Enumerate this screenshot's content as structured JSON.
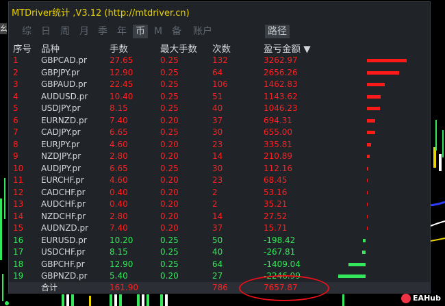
{
  "window": {
    "title": "MTDriver统计 ,V3.12 (http://mtdriver.cn)"
  },
  "side_tag": "幺",
  "tabs": [
    {
      "label": "综"
    },
    {
      "label": "日"
    },
    {
      "label": "周"
    },
    {
      "label": "月"
    },
    {
      "label": "季"
    },
    {
      "label": "年"
    },
    {
      "label": "币"
    },
    {
      "label": "M"
    },
    {
      "label": "备"
    },
    {
      "label": "账户"
    }
  ],
  "active_tab": "币",
  "route_button": "路径",
  "columns": {
    "seq": "序号",
    "symbol": "品种",
    "lots": "手数",
    "max_lots": "最大手数",
    "count": "次数",
    "profit": "盈亏金额 ▼"
  },
  "rows": [
    {
      "seq": "1",
      "symbol": "GBPCAD.pr",
      "lots": "27.65",
      "max_lots": "0.25",
      "count": "132",
      "profit": "3262.97",
      "value": 3262.97
    },
    {
      "seq": "2",
      "symbol": "GBPJPY.pr",
      "lots": "12.90",
      "max_lots": "0.25",
      "count": "64",
      "profit": "2656.26",
      "value": 2656.26
    },
    {
      "seq": "3",
      "symbol": "GBPAUD.pr",
      "lots": "22.45",
      "max_lots": "0.25",
      "count": "106",
      "profit": "1462.83",
      "value": 1462.83
    },
    {
      "seq": "4",
      "symbol": "AUDUSD.pr",
      "lots": "10.40",
      "max_lots": "0.25",
      "count": "51",
      "profit": "1143.62",
      "value": 1143.62
    },
    {
      "seq": "5",
      "symbol": "USDJPY.pr",
      "lots": "8.15",
      "max_lots": "0.25",
      "count": "40",
      "profit": "1046.23",
      "value": 1046.23
    },
    {
      "seq": "6",
      "symbol": "EURNZD.pr",
      "lots": "7.40",
      "max_lots": "0.20",
      "count": "37",
      "profit": "694.31",
      "value": 694.31
    },
    {
      "seq": "7",
      "symbol": "CADJPY.pr",
      "lots": "6.65",
      "max_lots": "0.25",
      "count": "30",
      "profit": "655.00",
      "value": 655.0
    },
    {
      "seq": "8",
      "symbol": "EURJPY.pr",
      "lots": "4.60",
      "max_lots": "0.20",
      "count": "23",
      "profit": "335.81",
      "value": 335.81
    },
    {
      "seq": "9",
      "symbol": "NZDJPY.pr",
      "lots": "2.80",
      "max_lots": "0.20",
      "count": "14",
      "profit": "210.89",
      "value": 210.89
    },
    {
      "seq": "10",
      "symbol": "AUDJPY.pr",
      "lots": "6.65",
      "max_lots": "0.25",
      "count": "30",
      "profit": "112.16",
      "value": 112.16
    },
    {
      "seq": "11",
      "symbol": "EURCHF.pr",
      "lots": "4.60",
      "max_lots": "0.20",
      "count": "23",
      "profit": "68.45",
      "value": 68.45
    },
    {
      "seq": "12",
      "symbol": "CADCHF.pr",
      "lots": "0.40",
      "max_lots": "0.20",
      "count": "2",
      "profit": "53.16",
      "value": 53.16
    },
    {
      "seq": "13",
      "symbol": "AUDCHF.pr",
      "lots": "0.40",
      "max_lots": "0.20",
      "count": "2",
      "profit": "35.21",
      "value": 35.21
    },
    {
      "seq": "14",
      "symbol": "NZDCHF.pr",
      "lots": "2.80",
      "max_lots": "0.20",
      "count": "14",
      "profit": "27.52",
      "value": 27.52
    },
    {
      "seq": "15",
      "symbol": "AUDNZD.pr",
      "lots": "7.40",
      "max_lots": "0.20",
      "count": "37",
      "profit": "15.71",
      "value": 15.71
    },
    {
      "seq": "16",
      "symbol": "EURUSD.pr",
      "lots": "10.20",
      "max_lots": "0.25",
      "count": "50",
      "profit": "-198.42",
      "value": -198.42
    },
    {
      "seq": "17",
      "symbol": "USDCHF.pr",
      "lots": "8.15",
      "max_lots": "0.25",
      "count": "40",
      "profit": "-267.81",
      "value": -267.81
    },
    {
      "seq": "18",
      "symbol": "GBPCHF.pr",
      "lots": "12.90",
      "max_lots": "0.25",
      "count": "64",
      "profit": "-1409.04",
      "value": -1409.04
    },
    {
      "seq": "19",
      "symbol": "GBPNZD.pr",
      "lots": "5.40",
      "max_lots": "0.20",
      "count": "27",
      "profit": "-2246.99",
      "value": -2246.99
    }
  ],
  "total": {
    "label": "合计",
    "lots": "161.90",
    "count": "786",
    "profit": "7657.87"
  },
  "watermark": "EAHub",
  "colors": {
    "title": "#e9d300",
    "positive": "#ff2020",
    "negative": "#33e85a",
    "panel": "#202328"
  }
}
